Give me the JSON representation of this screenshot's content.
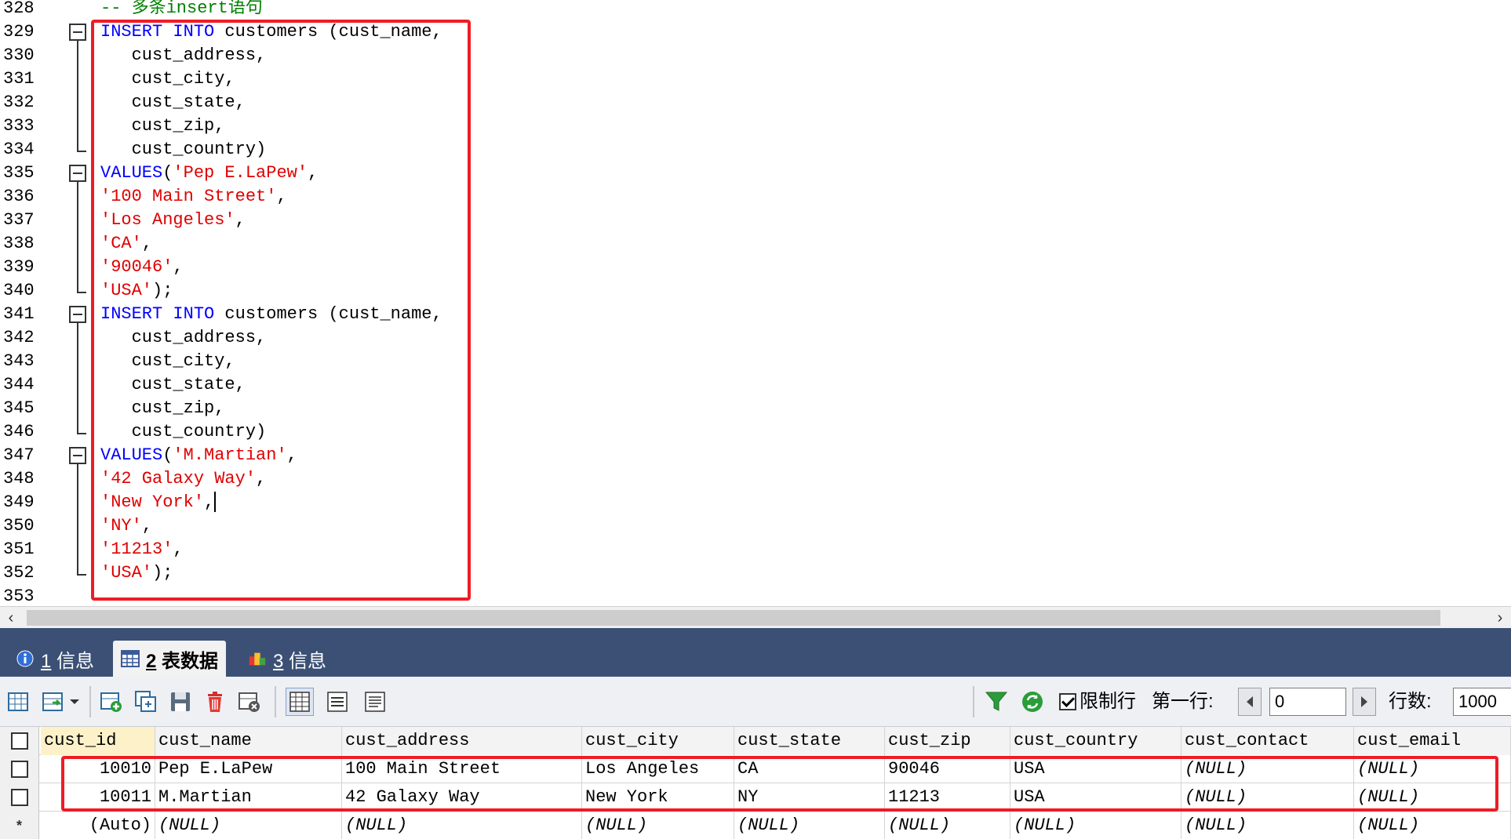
{
  "editor": {
    "lines": [
      {
        "n": "328",
        "tokens": [
          {
            "t": "-- 多条insert语句",
            "c": "cmt"
          }
        ]
      },
      {
        "n": "329",
        "tokens": [
          {
            "t": "INSERT INTO",
            "c": "kw"
          },
          {
            "t": " customers (cust_name,",
            "c": ""
          }
        ]
      },
      {
        "n": "330",
        "tokens": [
          {
            "t": "   cust_address,",
            "c": ""
          }
        ]
      },
      {
        "n": "331",
        "tokens": [
          {
            "t": "   cust_city,",
            "c": ""
          }
        ]
      },
      {
        "n": "332",
        "tokens": [
          {
            "t": "   cust_state,",
            "c": ""
          }
        ]
      },
      {
        "n": "333",
        "tokens": [
          {
            "t": "   cust_zip,",
            "c": ""
          }
        ]
      },
      {
        "n": "334",
        "tokens": [
          {
            "t": "   cust_country)",
            "c": ""
          }
        ]
      },
      {
        "n": "335",
        "tokens": [
          {
            "t": "VALUES",
            "c": "kw"
          },
          {
            "t": "(",
            "c": ""
          },
          {
            "t": "'Pep E.LaPew'",
            "c": "str"
          },
          {
            "t": ",",
            "c": ""
          }
        ]
      },
      {
        "n": "336",
        "tokens": [
          {
            "t": "'100 Main Street'",
            "c": "str"
          },
          {
            "t": ",",
            "c": ""
          }
        ]
      },
      {
        "n": "337",
        "tokens": [
          {
            "t": "'Los Angeles'",
            "c": "str"
          },
          {
            "t": ",",
            "c": ""
          }
        ]
      },
      {
        "n": "338",
        "tokens": [
          {
            "t": "'CA'",
            "c": "str"
          },
          {
            "t": ",",
            "c": ""
          }
        ]
      },
      {
        "n": "339",
        "tokens": [
          {
            "t": "'90046'",
            "c": "str"
          },
          {
            "t": ",",
            "c": ""
          }
        ]
      },
      {
        "n": "340",
        "tokens": [
          {
            "t": "'USA'",
            "c": "str"
          },
          {
            "t": ");",
            "c": ""
          }
        ]
      },
      {
        "n": "341",
        "tokens": [
          {
            "t": "INSERT INTO",
            "c": "kw"
          },
          {
            "t": " customers (cust_name,",
            "c": ""
          }
        ]
      },
      {
        "n": "342",
        "tokens": [
          {
            "t": "   cust_address,",
            "c": ""
          }
        ]
      },
      {
        "n": "343",
        "tokens": [
          {
            "t": "   cust_city,",
            "c": ""
          }
        ]
      },
      {
        "n": "344",
        "tokens": [
          {
            "t": "   cust_state,",
            "c": ""
          }
        ]
      },
      {
        "n": "345",
        "tokens": [
          {
            "t": "   cust_zip,",
            "c": ""
          }
        ]
      },
      {
        "n": "346",
        "tokens": [
          {
            "t": "   cust_country)",
            "c": ""
          }
        ]
      },
      {
        "n": "347",
        "tokens": [
          {
            "t": "VALUES",
            "c": "kw"
          },
          {
            "t": "(",
            "c": ""
          },
          {
            "t": "'M.Martian'",
            "c": "str"
          },
          {
            "t": ",",
            "c": ""
          }
        ]
      },
      {
        "n": "348",
        "tokens": [
          {
            "t": "'42 Galaxy Way'",
            "c": "str"
          },
          {
            "t": ",",
            "c": ""
          }
        ]
      },
      {
        "n": "349",
        "tokens": [
          {
            "t": "'New York'",
            "c": "str"
          },
          {
            "t": ",",
            "c": ""
          },
          {
            "t": "",
            "c": "caret"
          }
        ]
      },
      {
        "n": "350",
        "tokens": [
          {
            "t": "'NY'",
            "c": "str"
          },
          {
            "t": ",",
            "c": ""
          }
        ]
      },
      {
        "n": "351",
        "tokens": [
          {
            "t": "'11213'",
            "c": "str"
          },
          {
            "t": ",",
            "c": ""
          }
        ]
      },
      {
        "n": "352",
        "tokens": [
          {
            "t": "'USA'",
            "c": "str"
          },
          {
            "t": ");",
            "c": ""
          }
        ]
      },
      {
        "n": "353",
        "tokens": []
      }
    ]
  },
  "tabs": [
    {
      "num": "1",
      "label": "信息",
      "icon": "info-icon",
      "active": false
    },
    {
      "num": "2",
      "label": "表数据",
      "icon": "table-icon",
      "active": true
    },
    {
      "num": "3",
      "label": "信息",
      "icon": "chart-icon",
      "active": false
    }
  ],
  "toolbar": {
    "limit_label": "限制行",
    "limit_checked": true,
    "first_row_label": "第一行:",
    "first_row_value": "0",
    "row_count_label": "行数:",
    "row_count_value": "1000"
  },
  "grid": {
    "columns": [
      "cust_id",
      "cust_name",
      "cust_address",
      "cust_city",
      "cust_state",
      "cust_zip",
      "cust_country",
      "cust_contact",
      "cust_email"
    ],
    "rows": [
      [
        "10010",
        "Pep E.LaPew",
        "100 Main Street",
        "Los Angeles",
        "CA",
        "90046",
        "USA",
        "(NULL)",
        "(NULL)"
      ],
      [
        "10011",
        "M.Martian",
        "42 Galaxy Way",
        "New York",
        "NY",
        "11213",
        "USA",
        "(NULL)",
        "(NULL)"
      ]
    ],
    "new_row": [
      "(Auto)",
      "(NULL)",
      "(NULL)",
      "(NULL)",
      "(NULL)",
      "(NULL)",
      "(NULL)",
      "(NULL)",
      "(NULL)"
    ]
  },
  "colors": {
    "keyword": "#0000ff",
    "string": "#e00000",
    "comment": "#008000",
    "highlight": "#ee1c25",
    "tabbar": "#3c5075"
  }
}
